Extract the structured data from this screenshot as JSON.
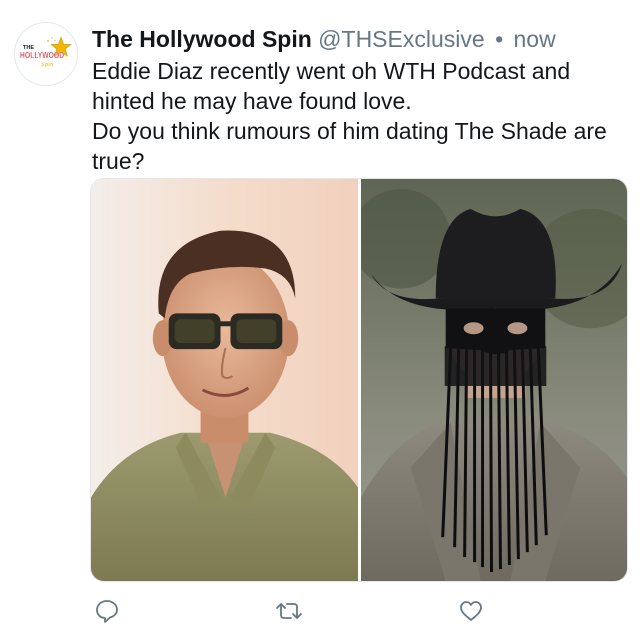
{
  "tweet": {
    "display_name": "The Hollywood Spin",
    "handle": "@THSExclusive",
    "separator": "•",
    "time": "now",
    "text_lines": [
      "Eddie Diaz recently went oh WTH Podcast and hinted he may have found love.",
      "Do you think rumours of him dating The Shade are true?"
    ],
    "avatar_logo": {
      "small_text": "THE",
      "main_text": "HOLLYWOOD",
      "script_text": "Spin",
      "icon": "gold-star-icon"
    },
    "media": {
      "left_photo": "photo-man-sunglasses",
      "right_photo": "photo-masked-cowboy"
    },
    "actions": {
      "reply_icon": "reply-bubble-icon",
      "retweet_icon": "retweet-arrows-icon",
      "like_icon": "heart-outline-icon"
    }
  },
  "colors": {
    "text": "#14171a",
    "secondary_text": "#657786",
    "icon_gray": "#657786",
    "logo_red": "#c8102e",
    "logo_gold": "#f2b705"
  }
}
